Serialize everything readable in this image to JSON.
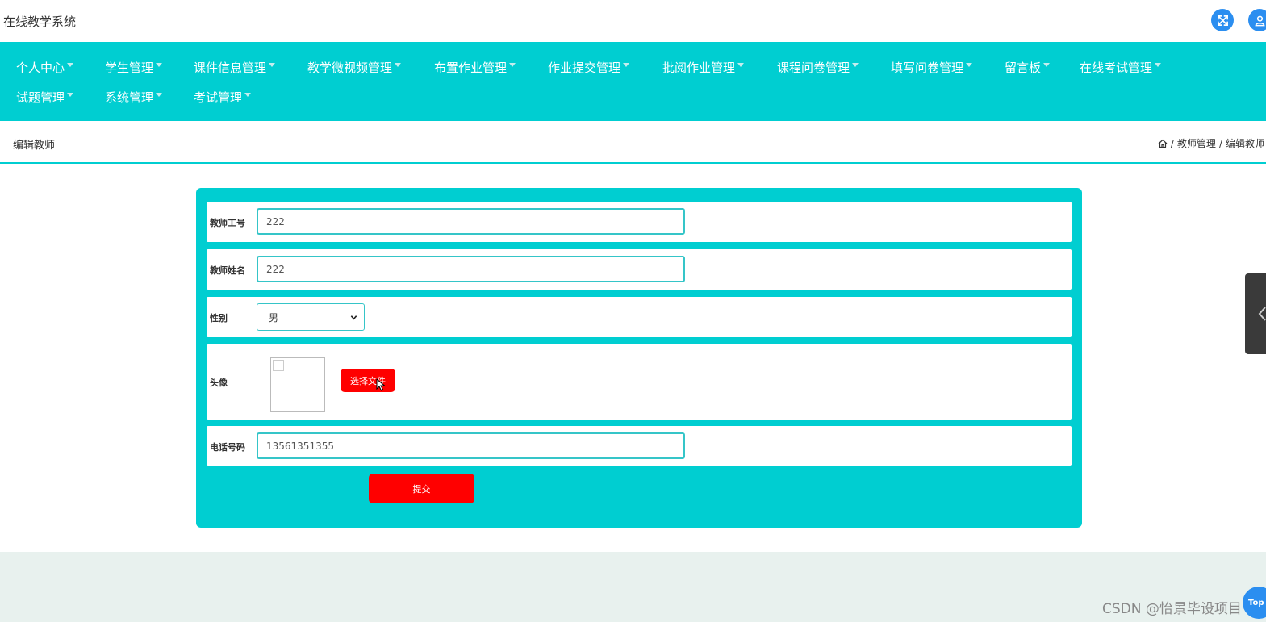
{
  "header": {
    "app_title": "在线教学系统",
    "icons": [
      "fullscreen-icon",
      "user-icon"
    ]
  },
  "nav": {
    "row1": [
      {
        "label": "个人中心"
      },
      {
        "label": "学生管理"
      },
      {
        "label": "课件信息管理"
      },
      {
        "label": "教学微视频管理"
      },
      {
        "label": "布置作业管理"
      },
      {
        "label": "作业提交管理"
      },
      {
        "label": "批阅作业管理"
      },
      {
        "label": "课程问卷管理"
      },
      {
        "label": "填写问卷管理"
      },
      {
        "label": "留言板"
      },
      {
        "label": "在线考试管理"
      }
    ],
    "row2": [
      {
        "label": "试题管理"
      },
      {
        "label": "系统管理"
      },
      {
        "label": "考试管理"
      }
    ]
  },
  "page": {
    "title": "编辑教师",
    "breadcrumb": [
      "教师管理",
      "编辑教师"
    ]
  },
  "form": {
    "teacher_id": {
      "label": "教师工号",
      "value": "222"
    },
    "teacher_name": {
      "label": "教师姓名",
      "value": "222"
    },
    "gender": {
      "label": "性别",
      "value": "男"
    },
    "avatar": {
      "label": "头像",
      "button_label": "选择文件"
    },
    "phone": {
      "label": "电话号码",
      "value": "13561351355"
    },
    "submit_label": "提交"
  },
  "footer": {
    "watermark": "CSDN @怡景毕设项目",
    "top_label": "Top"
  },
  "colors": {
    "accent": "#00ced1",
    "button": "#ff0000",
    "icon_blue": "#2b8ef0"
  }
}
